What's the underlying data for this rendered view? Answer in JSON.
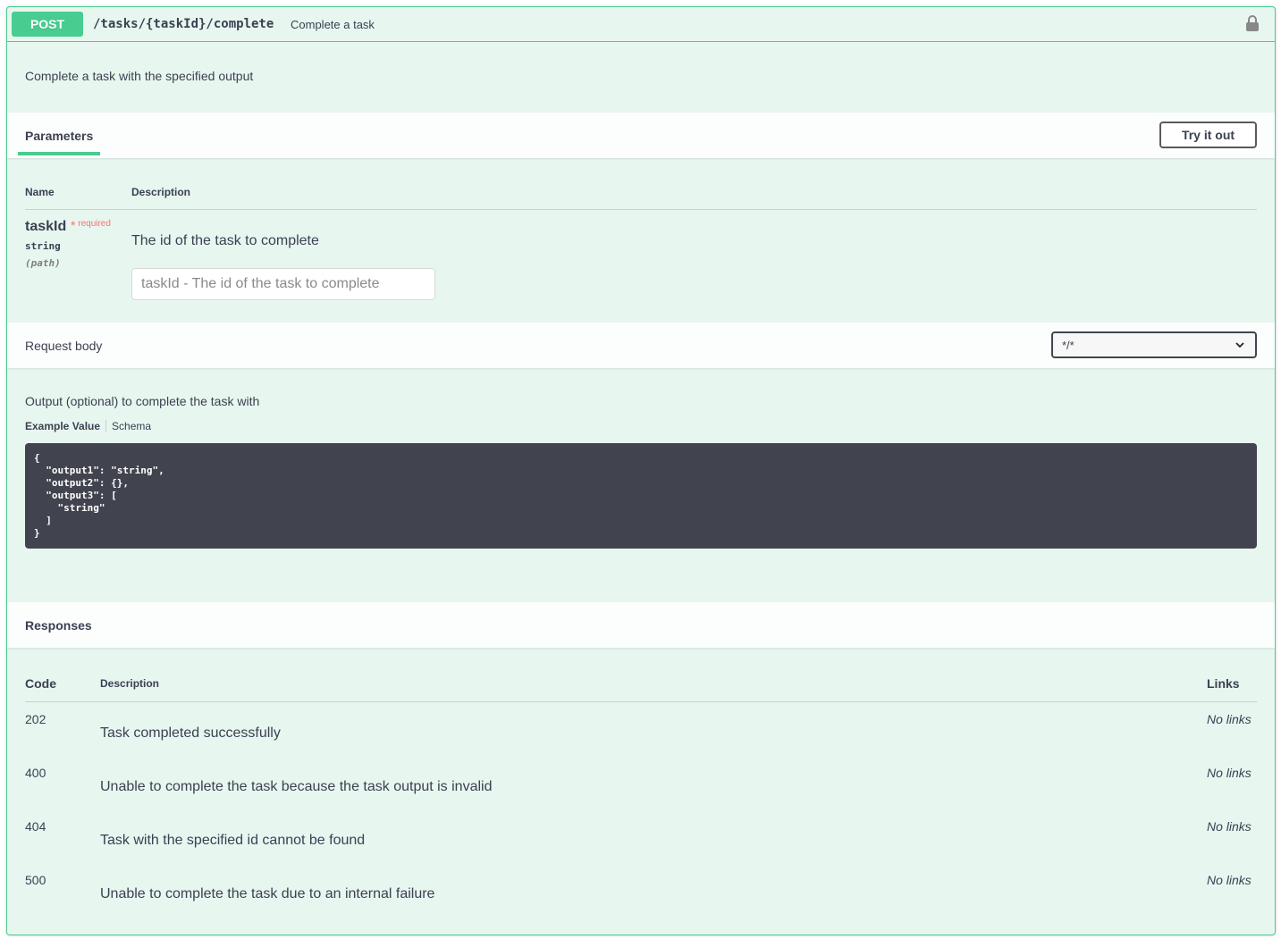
{
  "operation": {
    "method": "POST",
    "path": "/tasks/{taskId}/complete",
    "summary": "Complete a task",
    "description": "Complete a task with the specified output",
    "method_color": "#49cc90",
    "lock_icon": "lock-icon"
  },
  "parameters": {
    "tab_label": "Parameters",
    "try_label": "Try it out",
    "columns": {
      "name": "Name",
      "description": "Description"
    },
    "items": [
      {
        "name": "taskId",
        "required_star": "*",
        "required_label": "required",
        "type": "string",
        "in": "(path)",
        "description": "The id of the task to complete",
        "placeholder": "taskId - The id of the task to complete"
      }
    ]
  },
  "request_body": {
    "title": "Request body",
    "content_type": "*/*",
    "description": "Output (optional) to complete the task with",
    "tabs": [
      "Example Value",
      "Schema"
    ],
    "example": "{\n  \"output1\": \"string\",\n  \"output2\": {},\n  \"output3\": [\n    \"string\"\n  ]\n}"
  },
  "responses": {
    "title": "Responses",
    "columns": {
      "code": "Code",
      "description": "Description",
      "links": "Links"
    },
    "items": [
      {
        "code": "202",
        "description": "Task completed successfully",
        "links": "No links"
      },
      {
        "code": "400",
        "description": "Unable to complete the task because the task output is invalid",
        "links": "No links"
      },
      {
        "code": "404",
        "description": "Task with the specified id cannot be found",
        "links": "No links"
      },
      {
        "code": "500",
        "description": "Unable to complete the task due to an internal failure",
        "links": "No links"
      }
    ]
  }
}
